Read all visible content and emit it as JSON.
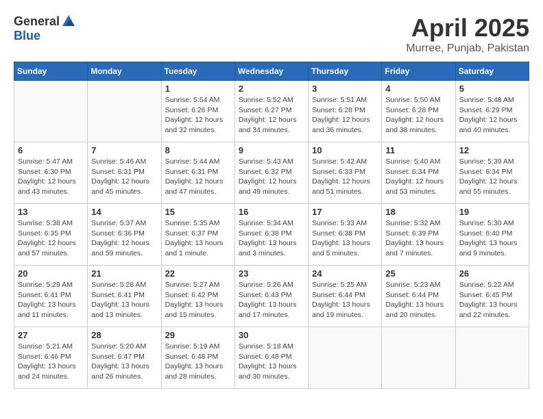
{
  "header": {
    "logo_general": "General",
    "logo_blue": "Blue",
    "month_year": "April 2025",
    "location": "Murree, Punjab, Pakistan"
  },
  "days_of_week": [
    "Sunday",
    "Monday",
    "Tuesday",
    "Wednesday",
    "Thursday",
    "Friday",
    "Saturday"
  ],
  "weeks": [
    [
      {
        "day": "",
        "info": ""
      },
      {
        "day": "",
        "info": ""
      },
      {
        "day": "1",
        "sunrise": "5:54 AM",
        "sunset": "6:26 PM",
        "daylight": "12 hours and 32 minutes."
      },
      {
        "day": "2",
        "sunrise": "5:52 AM",
        "sunset": "6:27 PM",
        "daylight": "12 hours and 34 minutes."
      },
      {
        "day": "3",
        "sunrise": "5:51 AM",
        "sunset": "6:28 PM",
        "daylight": "12 hours and 36 minutes."
      },
      {
        "day": "4",
        "sunrise": "5:50 AM",
        "sunset": "6:28 PM",
        "daylight": "12 hours and 38 minutes."
      },
      {
        "day": "5",
        "sunrise": "5:48 AM",
        "sunset": "6:29 PM",
        "daylight": "12 hours and 40 minutes."
      }
    ],
    [
      {
        "day": "6",
        "sunrise": "5:47 AM",
        "sunset": "6:30 PM",
        "daylight": "12 hours and 43 minutes."
      },
      {
        "day": "7",
        "sunrise": "5:46 AM",
        "sunset": "6:31 PM",
        "daylight": "12 hours and 45 minutes."
      },
      {
        "day": "8",
        "sunrise": "5:44 AM",
        "sunset": "6:31 PM",
        "daylight": "12 hours and 47 minutes."
      },
      {
        "day": "9",
        "sunrise": "5:43 AM",
        "sunset": "6:32 PM",
        "daylight": "12 hours and 49 minutes."
      },
      {
        "day": "10",
        "sunrise": "5:42 AM",
        "sunset": "6:33 PM",
        "daylight": "12 hours and 51 minutes."
      },
      {
        "day": "11",
        "sunrise": "5:40 AM",
        "sunset": "6:34 PM",
        "daylight": "12 hours and 53 minutes."
      },
      {
        "day": "12",
        "sunrise": "5:39 AM",
        "sunset": "6:34 PM",
        "daylight": "12 hours and 55 minutes."
      }
    ],
    [
      {
        "day": "13",
        "sunrise": "5:38 AM",
        "sunset": "6:35 PM",
        "daylight": "12 hours and 57 minutes."
      },
      {
        "day": "14",
        "sunrise": "5:37 AM",
        "sunset": "6:36 PM",
        "daylight": "12 hours and 59 minutes."
      },
      {
        "day": "15",
        "sunrise": "5:35 AM",
        "sunset": "6:37 PM",
        "daylight": "13 hours and 1 minute."
      },
      {
        "day": "16",
        "sunrise": "5:34 AM",
        "sunset": "6:38 PM",
        "daylight": "13 hours and 3 minutes."
      },
      {
        "day": "17",
        "sunrise": "5:33 AM",
        "sunset": "6:38 PM",
        "daylight": "13 hours and 5 minutes."
      },
      {
        "day": "18",
        "sunrise": "5:32 AM",
        "sunset": "6:39 PM",
        "daylight": "13 hours and 7 minutes."
      },
      {
        "day": "19",
        "sunrise": "5:30 AM",
        "sunset": "6:40 PM",
        "daylight": "13 hours and 9 minutes."
      }
    ],
    [
      {
        "day": "20",
        "sunrise": "5:29 AM",
        "sunset": "6:41 PM",
        "daylight": "13 hours and 11 minutes."
      },
      {
        "day": "21",
        "sunrise": "5:28 AM",
        "sunset": "6:41 PM",
        "daylight": "13 hours and 13 minutes."
      },
      {
        "day": "22",
        "sunrise": "5:27 AM",
        "sunset": "6:42 PM",
        "daylight": "13 hours and 15 minutes."
      },
      {
        "day": "23",
        "sunrise": "5:26 AM",
        "sunset": "6:43 PM",
        "daylight": "13 hours and 17 minutes."
      },
      {
        "day": "24",
        "sunrise": "5:25 AM",
        "sunset": "6:44 PM",
        "daylight": "13 hours and 19 minutes."
      },
      {
        "day": "25",
        "sunrise": "5:23 AM",
        "sunset": "6:44 PM",
        "daylight": "13 hours and 20 minutes."
      },
      {
        "day": "26",
        "sunrise": "5:22 AM",
        "sunset": "6:45 PM",
        "daylight": "13 hours and 22 minutes."
      }
    ],
    [
      {
        "day": "27",
        "sunrise": "5:21 AM",
        "sunset": "6:46 PM",
        "daylight": "13 hours and 24 minutes."
      },
      {
        "day": "28",
        "sunrise": "5:20 AM",
        "sunset": "6:47 PM",
        "daylight": "13 hours and 26 minutes."
      },
      {
        "day": "29",
        "sunrise": "5:19 AM",
        "sunset": "6:48 PM",
        "daylight": "13 hours and 28 minutes."
      },
      {
        "day": "30",
        "sunrise": "5:18 AM",
        "sunset": "6:48 PM",
        "daylight": "13 hours and 30 minutes."
      },
      {
        "day": "",
        "info": ""
      },
      {
        "day": "",
        "info": ""
      },
      {
        "day": "",
        "info": ""
      }
    ]
  ],
  "labels": {
    "sunrise": "Sunrise:",
    "sunset": "Sunset:",
    "daylight": "Daylight:"
  }
}
